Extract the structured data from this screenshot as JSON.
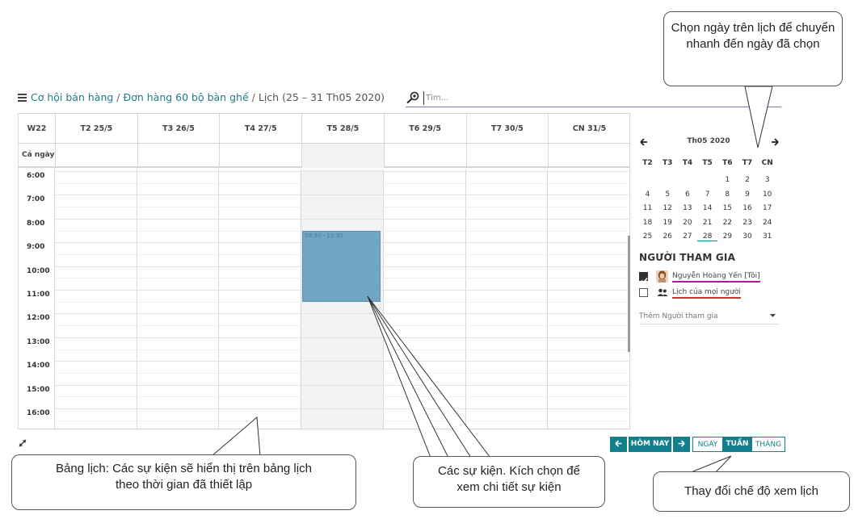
{
  "breadcrumb": {
    "items": [
      "Cơ hội bán hàng",
      "Đơn hàng 60 bộ bàn ghế"
    ],
    "current": "Lịch (25 – 31 Th05 2020)"
  },
  "search": {
    "placeholder": "Tìm..."
  },
  "calendar": {
    "week_label": "W22",
    "days": [
      "T2 25/5",
      "T3 26/5",
      "T4 27/5",
      "T5 28/5",
      "T6 29/5",
      "T7 30/5",
      "CN 31/5"
    ],
    "today_index": 3,
    "all_day_label": "Cả ngày",
    "hours": [
      "6:00",
      "7:00",
      "8:00",
      "9:00",
      "10:00",
      "11:00",
      "12:00",
      "13:00",
      "14:00",
      "15:00",
      "16:00"
    ],
    "events": [
      {
        "label": "08:30 - 11:30",
        "day_index": 3,
        "start_hour": 8.5,
        "end_hour": 11.5,
        "color": "#6ea6c3"
      }
    ]
  },
  "nav": {
    "prev_label": "←",
    "today_label": "HÔM NAY",
    "next_label": "→",
    "view_day": "NGÀY",
    "view_week": "TUẦN",
    "view_month": "THÁNG",
    "active_view": "TUẦN",
    "accent": "#137e8c"
  },
  "mini_calendar": {
    "title": "Th05 2020",
    "dow": [
      "T2",
      "T3",
      "T4",
      "T5",
      "T6",
      "T7",
      "CN"
    ],
    "weeks": [
      [
        "",
        "",
        "",
        "",
        "1",
        "2",
        "3"
      ],
      [
        "4",
        "5",
        "6",
        "7",
        "8",
        "9",
        "10"
      ],
      [
        "11",
        "12",
        "13",
        "14",
        "15",
        "16",
        "17"
      ],
      [
        "18",
        "19",
        "20",
        "21",
        "22",
        "23",
        "24"
      ],
      [
        "25",
        "26",
        "27",
        "28",
        "29",
        "30",
        "31"
      ]
    ],
    "selected": "28"
  },
  "attendees": {
    "title": "NGƯỜI THAM GIA",
    "items": [
      {
        "name": "Nguyễn Hoàng Yến [Tôi]",
        "checked": true,
        "underline": "#b0179c"
      },
      {
        "name": "Lịch của mọi người",
        "checked": false,
        "underline": "#c0392b"
      }
    ],
    "add_label": "Thêm Người tham gia"
  },
  "callouts": {
    "minical": "Chọn ngày trên lịch để chuyển nhanh đến ngày đã chọn",
    "grid": "Bảng lịch: Các sự kiện sẽ hiển thị trên bảng lịch theo thời gian đã thiết lập",
    "events": "Các sự kiện. Kích chọn để xem chi tiết sự kiện",
    "views": "Thay đổi chế độ xem lịch"
  }
}
